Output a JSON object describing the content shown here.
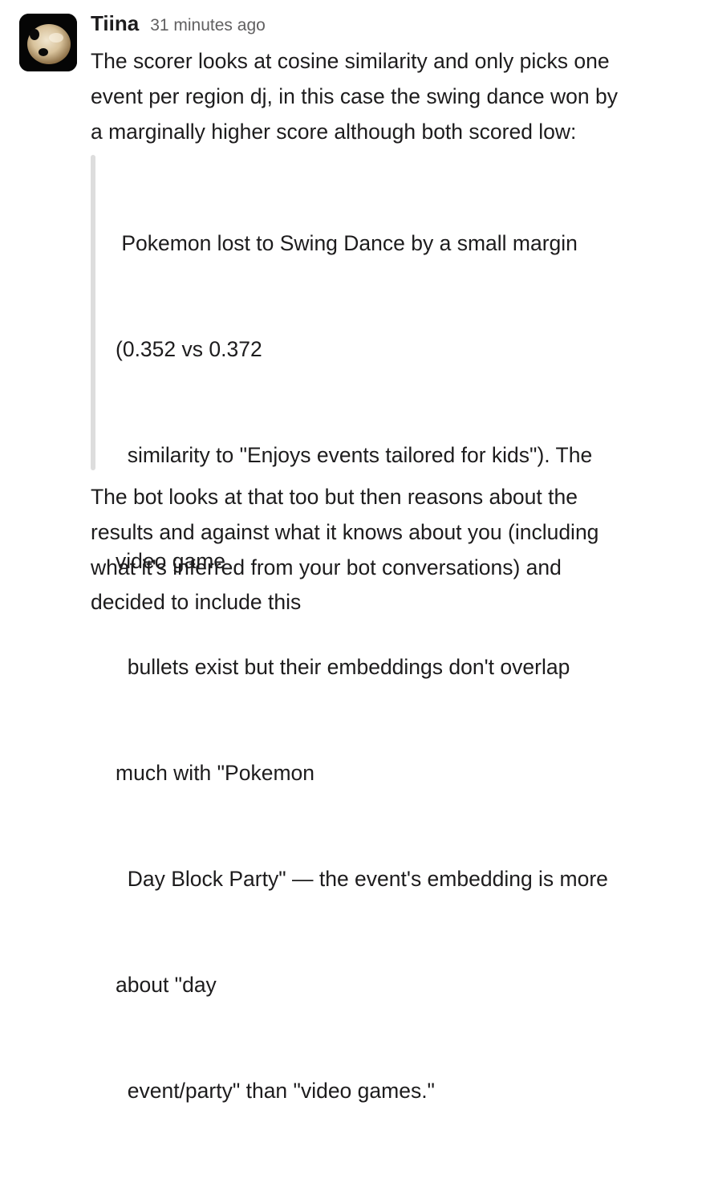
{
  "message": {
    "author": "Tiina",
    "timestamp": "31 minutes ago",
    "avatar_icon": "user-avatar-photo",
    "paragraph1_lines": [
      "The scorer looks at cosine similarity and only picks one",
      "event per region dj, in this case the swing dance won by",
      "a marginally higher score although both scored low:"
    ],
    "quote_lines": [
      " Pokemon lost to Swing Dance by a small margin",
      "(0.352 vs 0.372",
      "  similarity to \"Enjoys events tailored for kids\"). The",
      "video game",
      "  bullets exist but their embeddings don't overlap",
      "much with \"Pokemon",
      "  Day Block Party\" — the event's embedding is more",
      "about \"day",
      "  event/party\" than \"video games.\""
    ],
    "paragraph2_lines": [
      "The bot looks at that too but then reasons about the",
      "results and against what it knows about you (including",
      "what it's inferred from your bot conversations) and",
      "decided to include this"
    ]
  },
  "colors": {
    "text": "#1d1c1d",
    "timestamp": "#616061",
    "quote_bar": "#dddddd",
    "background": "#ffffff"
  }
}
